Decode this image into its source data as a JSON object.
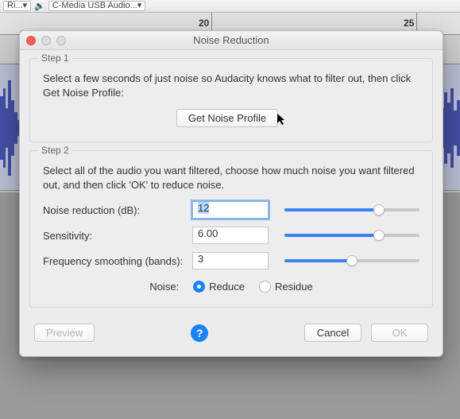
{
  "background": {
    "dropdown1": "Ri...",
    "dropdown2": "C-Media USB Audio...",
    "ruler": [
      "20",
      "25"
    ]
  },
  "dialog": {
    "title": "Noise Reduction",
    "step1": {
      "legend": "Step 1",
      "text": "Select a few seconds of just noise so Audacity knows what to filter out, then click Get Noise Profile:",
      "button": "Get Noise Profile"
    },
    "step2": {
      "legend": "Step 2",
      "text": "Select all of the audio you want filtered, choose how much noise you want filtered out, and then click 'OK' to reduce noise.",
      "params": {
        "noise_reduction": {
          "label": "Noise reduction (dB):",
          "value": "12",
          "slider_pct": 70
        },
        "sensitivity": {
          "label": "Sensitivity:",
          "value": "6.00",
          "slider_pct": 70
        },
        "freq_smoothing": {
          "label": "Frequency smoothing (bands):",
          "value": "3",
          "slider_pct": 50
        }
      },
      "radio_label": "Noise:",
      "reduce": "Reduce",
      "residue": "Residue",
      "selected": "reduce"
    },
    "footer": {
      "preview": "Preview",
      "help": "?",
      "cancel": "Cancel",
      "ok": "OK"
    }
  }
}
